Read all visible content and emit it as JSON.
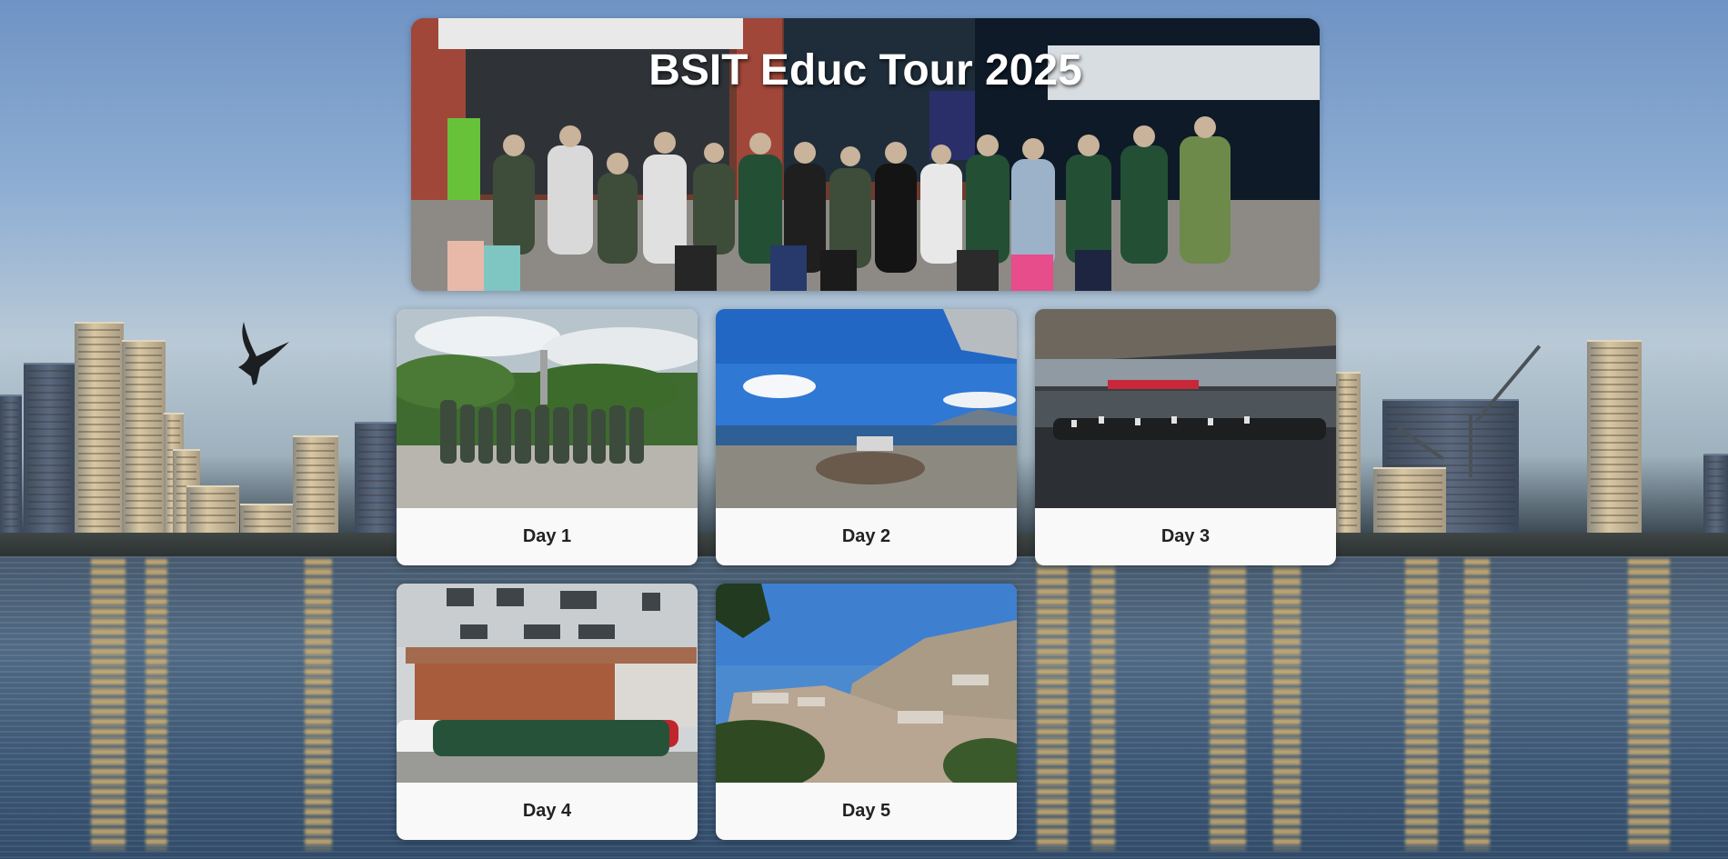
{
  "hero": {
    "title": "BSIT Educ Tour 2025"
  },
  "days": [
    {
      "label": "Day 1"
    },
    {
      "label": "Day 2"
    },
    {
      "label": "Day 3"
    },
    {
      "label": "Day 4"
    },
    {
      "label": "Day 5"
    }
  ],
  "colors": {
    "card_background": "#f9f9f9",
    "card_text": "#222222",
    "title_text": "#ffffff"
  }
}
